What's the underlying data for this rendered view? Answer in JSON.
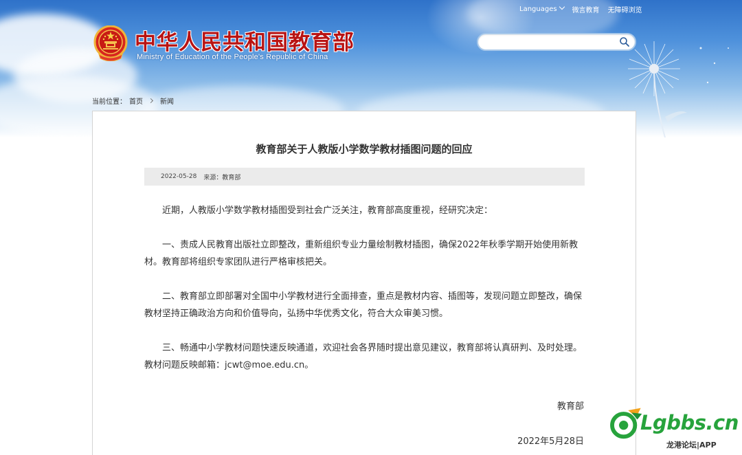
{
  "header": {
    "languages_label": "Languages",
    "weixin_label": "微言教育",
    "accessibility_label": "无障碍浏览",
    "site_title": "中华人民共和国教育部",
    "site_subtitle": "Ministry of Education of the People's Republic of China",
    "search_placeholder": "",
    "search_value": ""
  },
  "breadcrumb": {
    "prefix": "当前位置：",
    "home": "首页",
    "current": "新闻"
  },
  "article": {
    "title": "教育部关于人教版小学数学教材插图问题的回应",
    "date": "2022-05-28",
    "source": "来源：教育部",
    "paragraphs": [
      "近期，人教版小学数学教材插图受到社会广泛关注，教育部高度重视，经研究决定：",
      "一、责成人民教育出版社立即整改，重新组织专业力量绘制教材插图，确保2022年秋季学期开始使用新教材。教育部将组织专家团队进行严格审核把关。",
      "二、教育部立即部署对全国中小学教材进行全面排查，重点是教材内容、插图等，发现问题立即整改，确保教材坚持正确政治方向和价值导向，弘扬中华优秀文化，符合大众审美习惯。",
      "三、畅通中小学教材问题快速反映通道，欢迎社会各界随时提出意见建议，教育部将认真研判、及时处理。教材问题反映邮箱：jcwt@moe.edu.cn。"
    ],
    "signature": "教育部",
    "sign_date": "2022年5月28日"
  },
  "watermark": {
    "logo_text": "Lgbbs.cn",
    "sub_text": "龙港论坛|APP"
  },
  "colors": {
    "title_red": "#b81313",
    "sky_blue": "#4f92dc",
    "watermark_green": "#27a33c",
    "meta_bar_gray": "#ebebeb"
  },
  "icons": [
    "national-emblem-icon",
    "search-icon",
    "chevron-down-icon",
    "chevron-right-icon",
    "dandelion-decoration",
    "lgbbs-logo-icon"
  ]
}
